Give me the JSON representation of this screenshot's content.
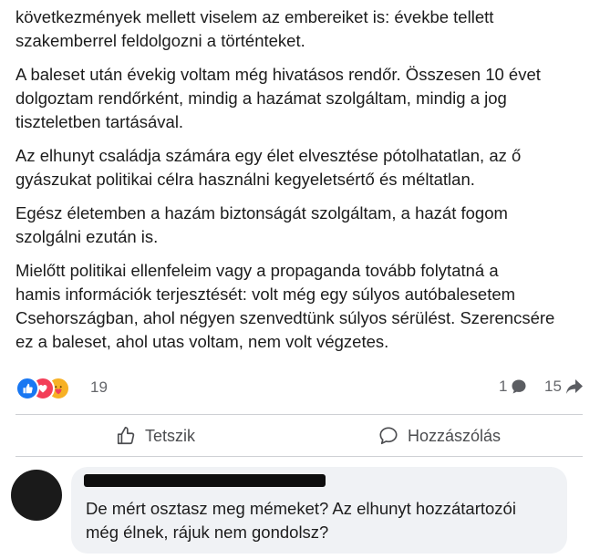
{
  "post": {
    "paragraphs": [
      "következmények mellett viselem az embereiket is: évekbe tellett\nszakemberrel feldolgozni a történteket.",
      "A baleset után évekig voltam még hivatásos rendőr. Összesen 10 évet\ndolgoztam rendőrként, mindig a hazámat szolgáltam, mindig a jog\ntiszteletben tartásával.",
      "Az elhunyt családja számára egy élet elvesztése pótolhatatlan, az ő\ngyászukat politikai célra használni kegyeletsértő és méltatlan.",
      "Egész életemben a hazám biztonságát szolgáltam, a hazát fogom\nszolgálni ezután is.",
      "Mielőtt politikai ellenfeleim vagy a propaganda tovább folytatná a\nhamis információk terjesztését: volt még egy súlyos autóbalesetem\nCsehországban, ahol négyen szenvedtünk súlyos sérülést. Szerencsére\nez a baleset, ahol utas voltam, nem volt végzetes."
    ]
  },
  "reactions": {
    "icons": [
      "like-reaction-icon",
      "love-reaction-icon",
      "care-reaction-icon"
    ],
    "count": "19",
    "comments_count": "1",
    "shares_count": "15"
  },
  "actions": {
    "like_label": "Tetszik",
    "comment_label": "Hozzászólás"
  },
  "comment": {
    "text": "De mért osztasz meg mémeket? Az elhunyt hozzátartozói\nmég élnek, rájuk nem gondolsz?"
  },
  "colors": {
    "like_blue": "#1877f2",
    "love_red": "#f33e58",
    "care_yellow": "#f7b125",
    "muted_text": "#65676b",
    "bubble_bg": "#f0f2f5"
  }
}
